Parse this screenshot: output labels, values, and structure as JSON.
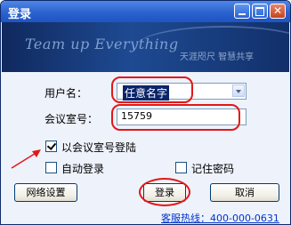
{
  "window": {
    "title": "登录"
  },
  "banner": {
    "slogan": "Team up Everything",
    "tagline": "天涯咫尺 智慧共享"
  },
  "form": {
    "username_label": "用户名：",
    "username_value": "任意名字",
    "room_label": "会议室号：",
    "room_value": "15759",
    "login_by_room_label": "以会议室号登陆",
    "login_by_room_checked": true,
    "auto_login_label": "自动登录",
    "auto_login_checked": false,
    "remember_password_label": "记住密码",
    "remember_password_checked": false
  },
  "buttons": {
    "network": "网络设置",
    "login": "登录",
    "cancel": "取消"
  },
  "footer": {
    "hotline": "客服热线：400-000-0631"
  },
  "colors": {
    "annotation": "#e21818",
    "titlebar": "#2a62cf",
    "link": "#0033cc"
  }
}
